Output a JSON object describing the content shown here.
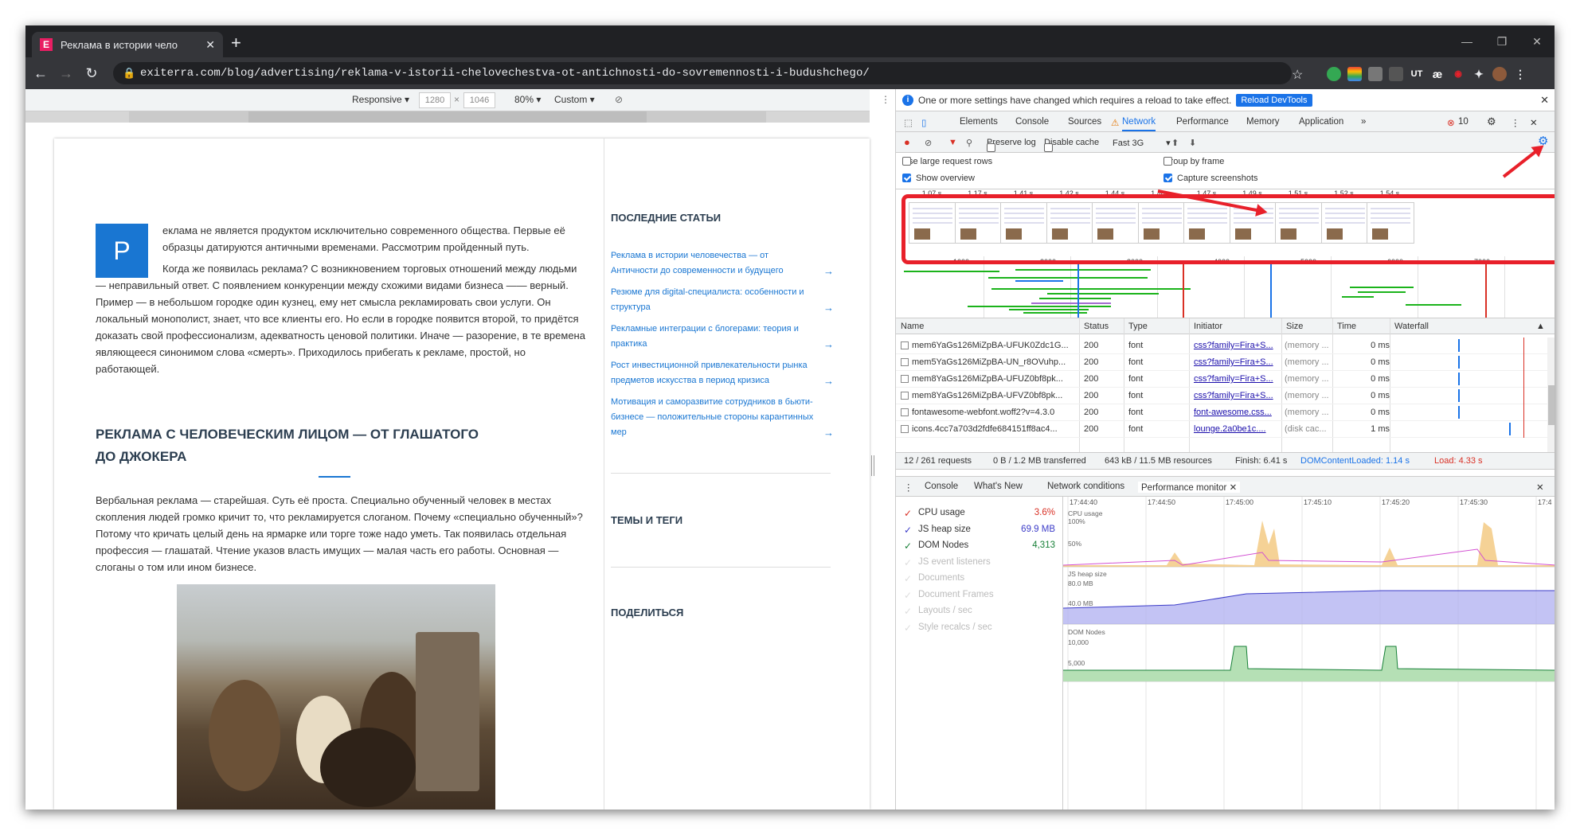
{
  "browser": {
    "tab_title": "Реклама в истории чело",
    "favicon_letter": "E",
    "url_host": "exiterra.com",
    "url_path": "/blog/advertising/reklama-v-istorii-chelovechestva-ot-antichnosti-do-sovremennosti-i-budushchego/",
    "ext_labels": [
      "UT",
      "æ"
    ]
  },
  "device_toolbar": {
    "mode": "Responsive",
    "width": "1280",
    "height": "1046",
    "zoom": "80%",
    "throttle": "Custom"
  },
  "article": {
    "drop_cap": "Р",
    "p1": "еклама не является продуктом исключительно современного общества. Первые её образцы датируются античными временами. Рассмотрим пройденный путь.",
    "p2": "Когда же появилась реклама? С возникновением торговых отношений между людьми — неправильный ответ. С появлением конкуренции между схожими видами бизнеса —— верный. Пример — в небольшом городке один кузнец, ему нет смысла рекламировать свои услуги. Он локальный монополист, знает, что все клиенты его. Но если в городке появится второй, то придётся доказать свой профессионализм, адекватность ценовой политики. Иначе — разорение, в те времена являющееся синонимом слова «смерть». Приходилось прибегать к рекламе, простой, но работающей.",
    "heading": "Реклама с человеческим лицом — от глашатого до джокера",
    "p3": "Вербальная реклама — старейшая. Суть её проста. Специально обученный человек в местах скопления людей громко кричит то, что рекламируется слоганом. Почему «специально обученный»? Потому что кричать целый день на ярмарке или торге тоже надо уметь. Так появилась отдельная профессия — глашатай. Чтение указов власть имущих — малая часть его работы. Основная — слоганы о том или ином бизнесе."
  },
  "sidebar": {
    "recent_title": "Последние статьи",
    "links": [
      "Реклама в истории человечества — от Античности до современности и будущего",
      "Резюме для digital-специалиста: особенности и структура",
      "Рекламные интеграции с блогерами: теория и практика",
      "Рост инвестиционной привлекательности рынка предметов искусства в период кризиса",
      "Мотивация и саморазвитие сотрудников в бьюти-бизнесе — положительные стороны карантинных мер"
    ],
    "topics_title": "Темы и теги",
    "share_title": "Поделиться"
  },
  "devtools": {
    "info_text": "One or more settings have changed which requires a reload to take effect.",
    "reload_label": "Reload DevTools",
    "tabs": [
      "Elements",
      "Console",
      "Sources",
      "Network",
      "Performance",
      "Memory",
      "Application"
    ],
    "more_tabs": "»",
    "error_count": "10",
    "toolbar": {
      "preserve_log": "Preserve log",
      "disable_cache": "Disable cache",
      "throttle": "Fast 3G"
    },
    "settings": {
      "large_rows": "Use large request rows",
      "show_overview": "Show overview",
      "group_by_frame": "Group by frame",
      "capture_screenshots": "Capture screenshots"
    },
    "screenshot_times": [
      "1.07 s",
      "1.17 s",
      "1.41 s",
      "1.42 s",
      "1.44 s",
      "1.46 s",
      "1.47 s",
      "1.49 s",
      "1.51 s",
      "1.52 s",
      "1.54 s"
    ],
    "overview_ticks": [
      "1000 ms",
      "2000 ms",
      "3000 ms",
      "4000 ms",
      "5000 ms",
      "6000 ms",
      "7000 ms"
    ],
    "columns": [
      "Name",
      "Status",
      "Type",
      "Initiator",
      "Size",
      "Time",
      "Waterfall"
    ],
    "rows": [
      {
        "name": "mem6YaGs126MiZpBA-UFUK0Zdc1G...",
        "status": "200",
        "type": "font",
        "initiator": "css?family=Fira+S...",
        "size": "(memory ...",
        "time": "0 ms"
      },
      {
        "name": "mem5YaGs126MiZpBA-UN_r8OVuhp...",
        "status": "200",
        "type": "font",
        "initiator": "css?family=Fira+S...",
        "size": "(memory ...",
        "time": "0 ms"
      },
      {
        "name": "mem8YaGs126MiZpBA-UFUZ0bf8pk...",
        "status": "200",
        "type": "font",
        "initiator": "css?family=Fira+S...",
        "size": "(memory ...",
        "time": "0 ms"
      },
      {
        "name": "mem8YaGs126MiZpBA-UFVZ0bf8pk...",
        "status": "200",
        "type": "font",
        "initiator": "css?family=Fira+S...",
        "size": "(memory ...",
        "time": "0 ms"
      },
      {
        "name": "fontawesome-webfont.woff2?v=4.3.0",
        "status": "200",
        "type": "font",
        "initiator": "font-awesome.css...",
        "size": "(memory ...",
        "time": "0 ms"
      },
      {
        "name": "icons.4cc7a703d2fdfe684151ff8ac4...",
        "status": "200",
        "type": "font",
        "initiator": "lounge.2a0be1c....",
        "size": "(disk cac...",
        "time": "1 ms"
      }
    ],
    "status_bar": {
      "requests": "12 / 261 requests",
      "transferred": "0 B / 1.2 MB transferred",
      "resources": "643 kB / 11.5 MB resources",
      "finish": "Finish: 6.41 s",
      "dcl": "DOMContentLoaded: 1.14 s",
      "load": "Load: 4.33 s"
    },
    "drawer_tabs": [
      "Console",
      "What's New",
      "Network conditions",
      "Performance monitor"
    ],
    "metrics": [
      {
        "label": "CPU usage",
        "value": "3.6%",
        "on": true,
        "color": "#d93025"
      },
      {
        "label": "JS heap size",
        "value": "69.9 MB",
        "on": true,
        "color": "#3c3cc8"
      },
      {
        "label": "DOM Nodes",
        "value": "4,313",
        "on": true,
        "color": "#188038"
      },
      {
        "label": "JS event listeners",
        "value": "",
        "on": false
      },
      {
        "label": "Documents",
        "value": "",
        "on": false
      },
      {
        "label": "Document Frames",
        "value": "",
        "on": false
      },
      {
        "label": "Layouts / sec",
        "value": "",
        "on": false
      },
      {
        "label": "Style recalcs / sec",
        "value": "",
        "on": false
      }
    ],
    "perf_times": [
      "17:44:40",
      "17:44:50",
      "17:45:00",
      "17:45:10",
      "17:45:20",
      "17:45:30",
      "17:4"
    ],
    "perf_labels": {
      "cpu": "CPU usage",
      "cpu100": "100%",
      "cpu50": "50%",
      "heap": "JS heap size",
      "heap80": "80.0 MB",
      "heap40": "40.0 MB",
      "dom": "DOM Nodes",
      "dom10k": "10,000",
      "dom5k": "5,000"
    }
  }
}
